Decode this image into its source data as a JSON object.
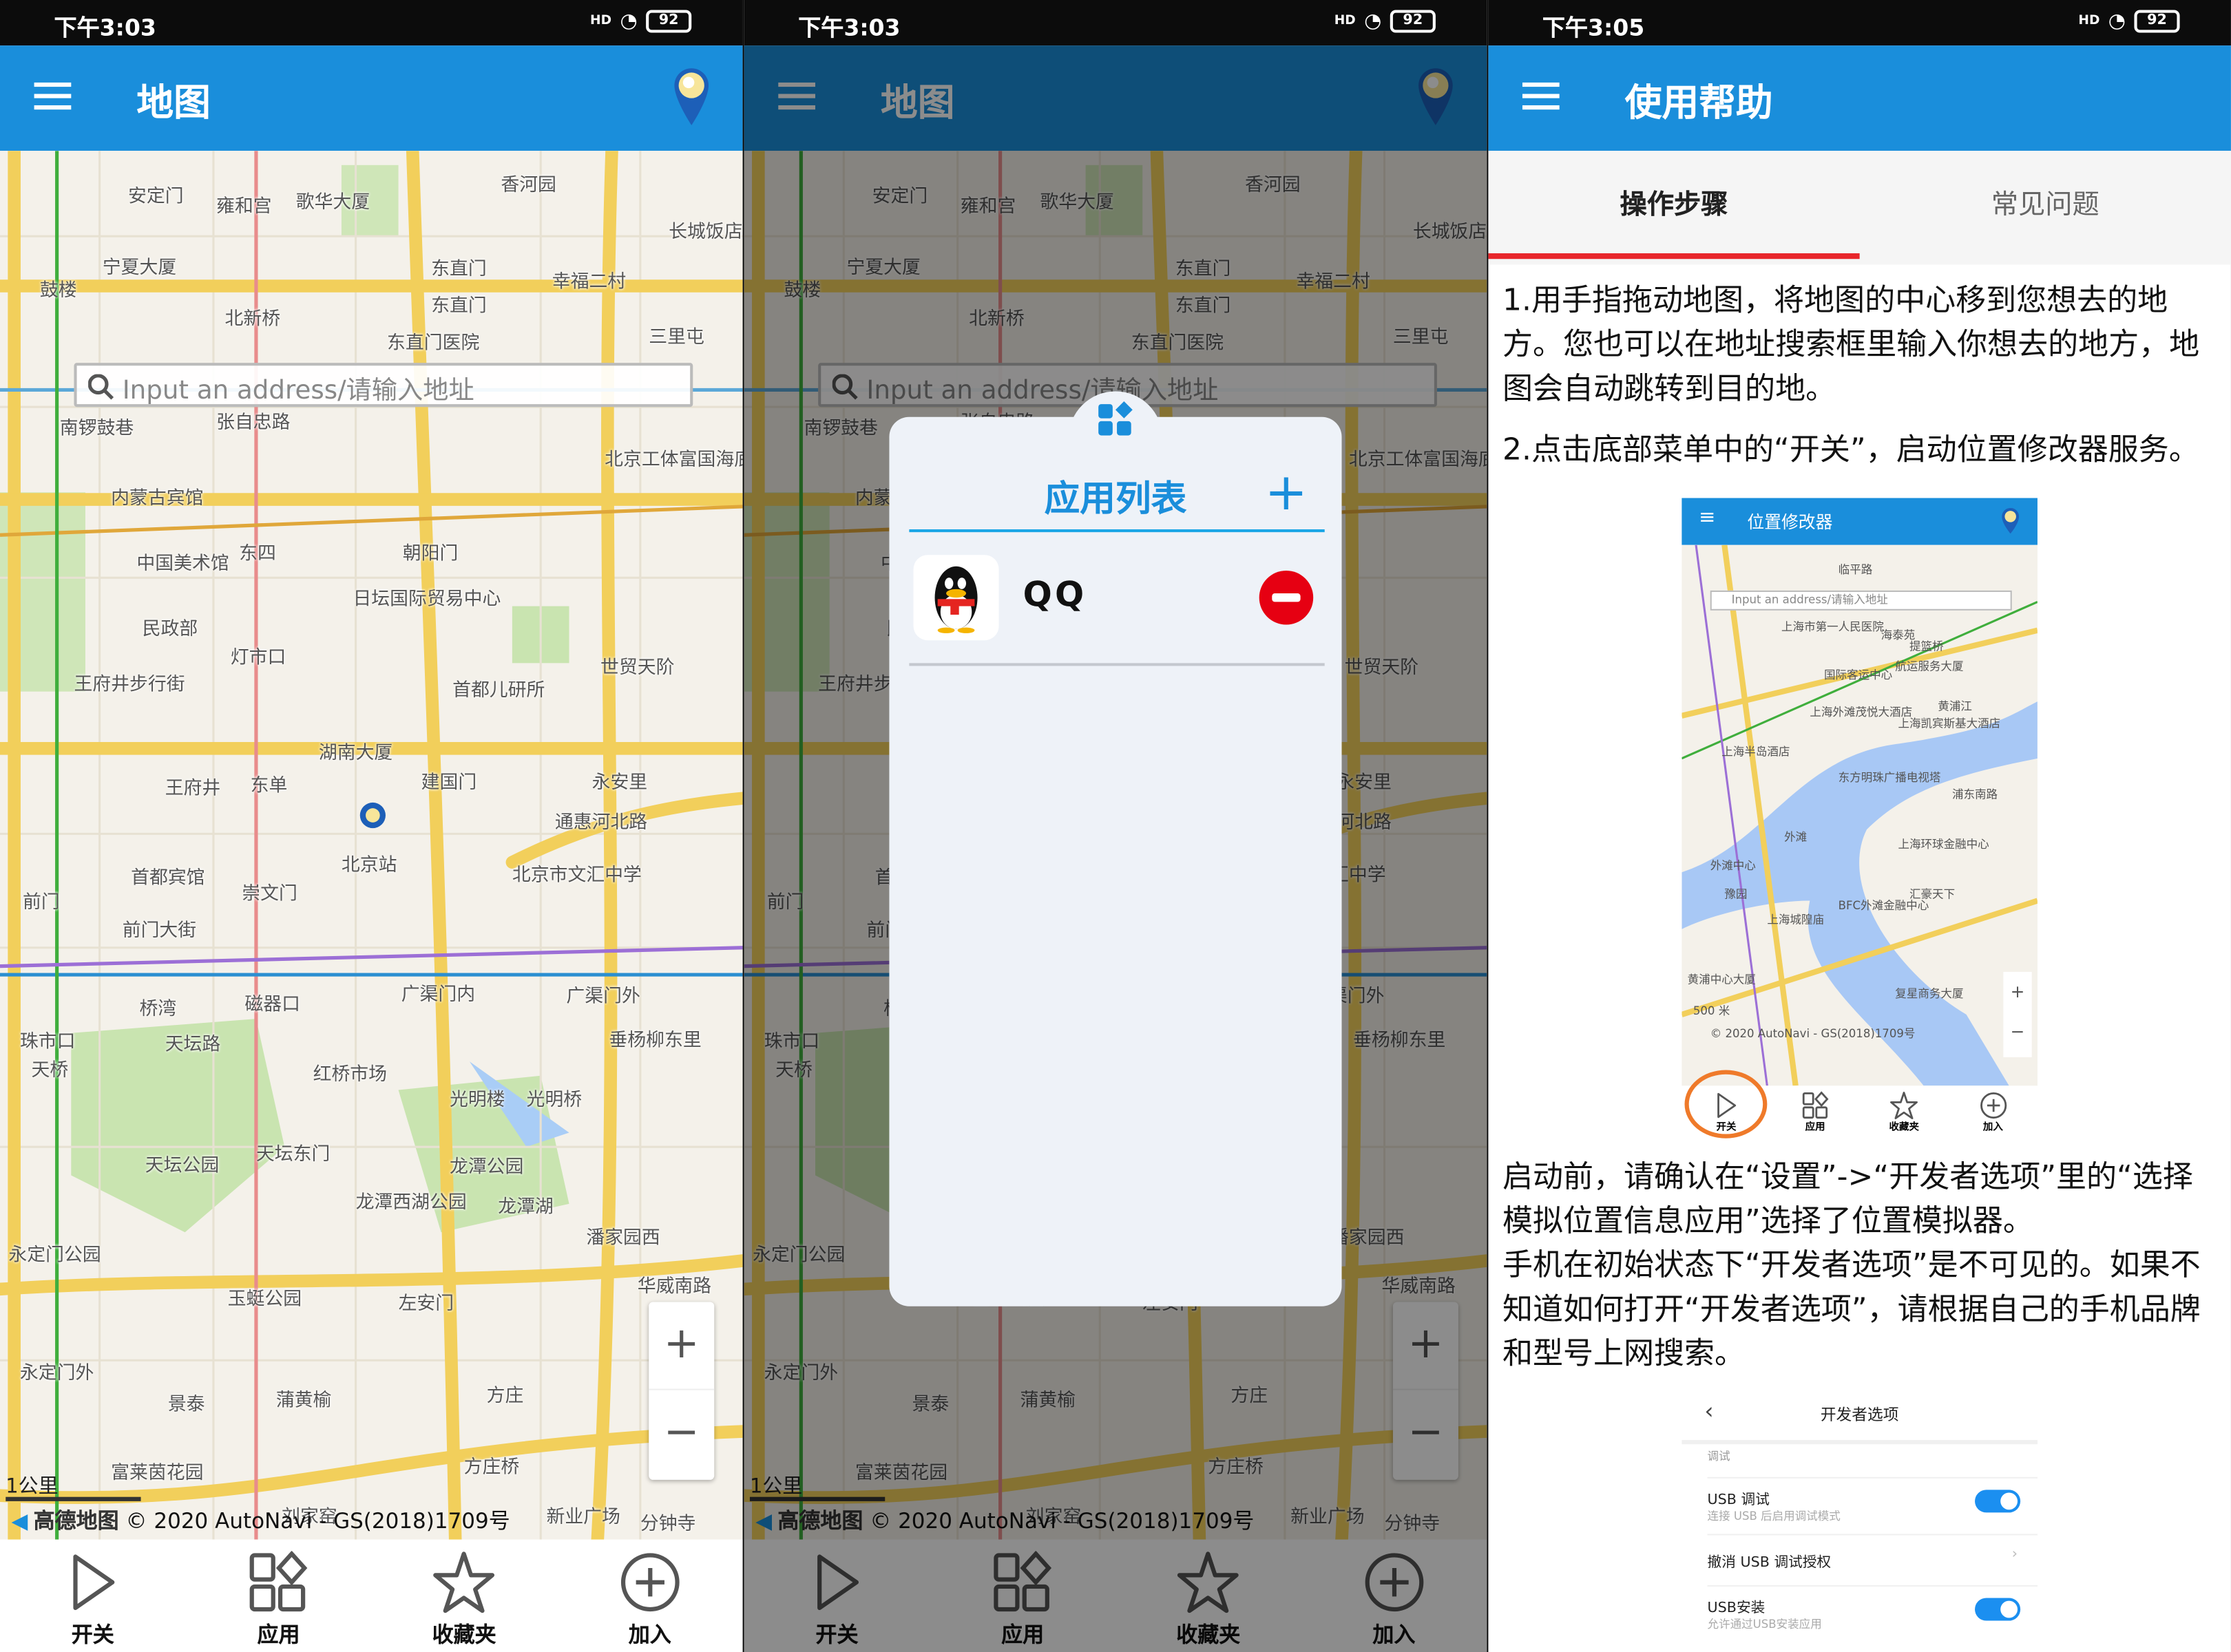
{
  "status": {
    "times": [
      "下午3:03",
      "下午3:03",
      "下午3:05"
    ],
    "battery": "92",
    "network": "HD"
  },
  "map_screen": {
    "title": "地图",
    "search_placeholder": "Input an address/请输入地址",
    "scale": "1公里",
    "attribution_brand": "高德地图",
    "attribution": "© 2020 AutoNavi - GS(2018)1709号",
    "zoom_in": "+",
    "zoom_out": "−",
    "labels": [
      "安定门",
      "雍和宫",
      "歌华大厦",
      "香河园",
      "宁夏大厦",
      "鼓楼",
      "北新桥",
      "东直门",
      "幸福二村",
      "东直门医院",
      "南锣鼓巷",
      "张自忠路",
      "内蒙古宾馆",
      "中国美术馆",
      "东四",
      "朝阳门",
      "北京工体富国海底世界",
      "日坛国际贸易中心",
      "民政部",
      "灯市口",
      "王府井步行街",
      "首都儿研所",
      "世贸天阶",
      "湖南大厦",
      "王府井",
      "东单",
      "建国门",
      "永安里",
      "北京站",
      "北京市文汇中学",
      "首都宾馆",
      "崇文门",
      "前门",
      "前门大街",
      "广渠门内",
      "桥湾",
      "磁器口",
      "广渠门外",
      "天坛路",
      "垂杨柳东里",
      "珠市口",
      "红桥市场",
      "光明楼",
      "光明桥",
      "天坛公园",
      "天坛东门",
      "龙潭公园",
      "龙潭西湖公园",
      "龙潭湖",
      "潘家园西",
      "永定门公园",
      "玉蜓公园",
      "左安门",
      "华威南路",
      "永定门外",
      "景泰",
      "蒲黄榆",
      "方庄",
      "方庄桥",
      "富莱茵花园",
      "刘家窑",
      "新业广场",
      "通惠河北路",
      "长城饭店",
      "东直门",
      "三里屯",
      "天桥",
      "分钟寺"
    ]
  },
  "bottom_nav": [
    {
      "icon": "play-icon",
      "label": "开关"
    },
    {
      "icon": "apps-icon",
      "label": "应用"
    },
    {
      "icon": "star-icon",
      "label": "收藏夹"
    },
    {
      "icon": "add-circle-icon",
      "label": "加入"
    }
  ],
  "app_dialog": {
    "title": "应用列表",
    "add": "+",
    "apps": [
      {
        "name": "QQ"
      }
    ]
  },
  "help_screen": {
    "title": "使用帮助",
    "tabs": [
      {
        "label": "操作步骤",
        "active": true
      },
      {
        "label": "常见问题",
        "active": false
      }
    ],
    "p1": "1.用手指拖动地图，将地图的中心移到您想去的地方。您也可以在地址搜索框里输入你想去的地方，地图会自动跳转到目的地。",
    "p2": "2.点击底部菜单中的“开关”，启动位置修改器服务。",
    "p3": "启动前，请确认在“设置”->“开发者选项”里的“选择模拟位置信息应用”选择了位置模拟器。",
    "p4": "手机在初始状态下“开发者选项”是不可见的。如果不知道如何打开“开发者选项”，请根据自己的手机品牌和型号上网搜索。",
    "mini": {
      "title": "位置修改器",
      "search": "Input an address/请输入地址",
      "labels": [
        "临平路",
        "上海市第一人民医院",
        "海泰苑",
        "提篮桥",
        "航运服务大厦",
        "国际客运中心",
        "上海外滩茂悦大酒店",
        "上海凯宾斯基大酒店",
        "黄浦江",
        "上海半岛酒店",
        "东方明珠广播电视塔",
        "浦东南路",
        "外滩",
        "外滩中心",
        "上海环球金融中心",
        "豫园",
        "上海城隍庙",
        "BFC外滩金融中心",
        "汇豪天下",
        "黄浦中心大厦",
        "复星商务大厦",
        "500 米",
        "© 2020 AutoNavi - GS(2018)1709号"
      ],
      "nav": [
        "开关",
        "应用",
        "收藏夹",
        "加入"
      ]
    },
    "dev": {
      "title": "开发者选项",
      "section": "调试",
      "rows": [
        {
          "title": "USB 调试",
          "sub": "连接 USB 后启用调试模式",
          "toggle": true
        },
        {
          "title": "撤消 USB 调试授权",
          "sub": "",
          "toggle": false
        },
        {
          "title": "USB安装",
          "sub": "允许通过USB安装应用",
          "toggle": true
        }
      ]
    }
  },
  "colors": {
    "primary": "#1a8edb",
    "accent_red": "#e8262b",
    "road": "#f2cf5b",
    "remove": "#e60012"
  }
}
